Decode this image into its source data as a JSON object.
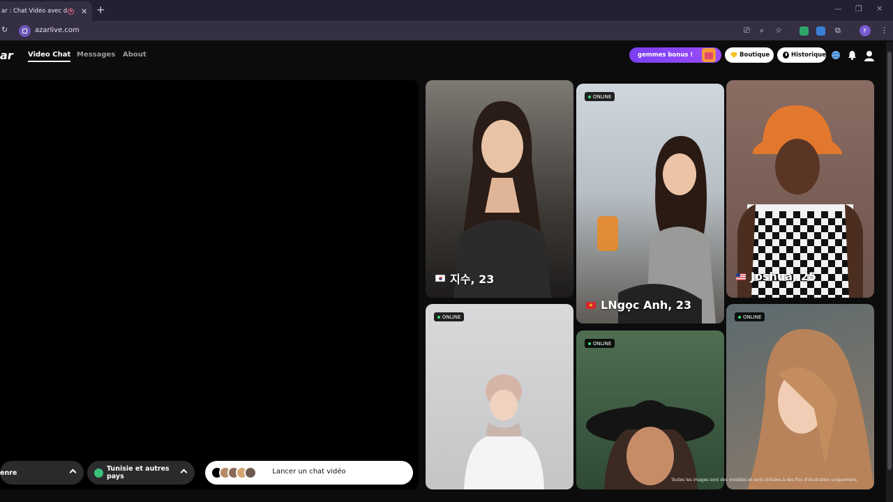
{
  "browser": {
    "tab_title": "ar : Chat Vidéo avec de n",
    "url": "azarlive.com",
    "profile_initial": "F"
  },
  "site": {
    "logo": "ar",
    "nav": [
      "Video Chat",
      "Messages",
      "About"
    ],
    "bonus_label": "gemmes bonus !",
    "shop_label": "Boutique",
    "history_label": "Historique"
  },
  "controls": {
    "gender_label": "enre",
    "region_label_line1": "Tunisie et autres",
    "region_label_line2": "pays",
    "launch_label": "Lancer un chat vidéo"
  },
  "gallery": {
    "online_label": "ONLINE",
    "profiles": [
      {
        "name": "지수, 23",
        "flag": "kr"
      },
      {
        "name": "LNgọc Anh, 23",
        "flag": "vn"
      },
      {
        "name": "Joshua, 25",
        "flag": "us"
      }
    ],
    "disclaimer": "Toutes les images sont des modèles et sont utilisées à des fins d'illustration uniquement."
  },
  "colors": {
    "accent_purple": "#8b45f6",
    "online_green": "#3ee07a",
    "gem_yellow": "#f5c020"
  }
}
